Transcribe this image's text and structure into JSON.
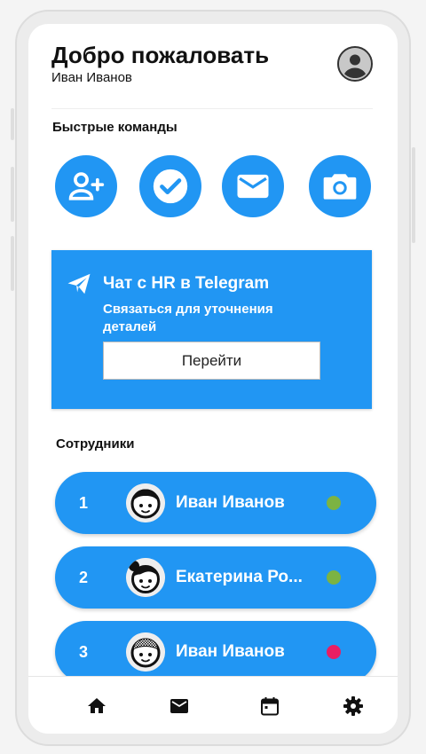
{
  "header": {
    "title": "Добро пожаловать",
    "user_name": "Иван Иванов",
    "avatar_icon": "account-circle-icon"
  },
  "quick_commands": {
    "title": "Быстрые команды",
    "items": [
      {
        "icon": "add-person-icon"
      },
      {
        "icon": "check-icon"
      },
      {
        "icon": "mail-icon"
      },
      {
        "icon": "camera-icon"
      }
    ]
  },
  "telegram_card": {
    "icon": "send-icon",
    "title": "Чат с HR в Telegram",
    "description": "Связаться для уточнения деталей",
    "button_label": "Перейти"
  },
  "employees": {
    "title": "Сотрудники",
    "items": [
      {
        "number": "1",
        "name": "Иван Иванов",
        "status_color": "#7cb342"
      },
      {
        "number": "2",
        "name": "Екатерина Ро...",
        "status_color": "#7cb342"
      },
      {
        "number": "3",
        "name": "Иван Иванов",
        "status_color": "#e91e63"
      }
    ]
  },
  "bottom_nav": {
    "items": [
      {
        "icon": "home-icon"
      },
      {
        "icon": "mail-icon"
      },
      {
        "icon": "calendar-icon"
      },
      {
        "icon": "settings-icon"
      }
    ]
  },
  "colors": {
    "accent": "#2196f3",
    "status_online": "#7cb342",
    "status_offline": "#e91e63"
  }
}
